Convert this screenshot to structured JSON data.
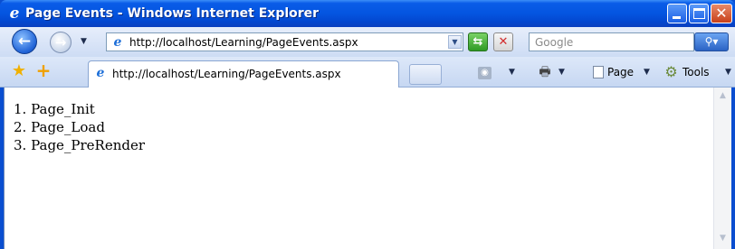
{
  "window": {
    "title": "Page Events - Windows Internet Explorer"
  },
  "navbar": {
    "address": "http://localhost/Learning/PageEvents.aspx",
    "search_placeholder": "Google"
  },
  "tabs": {
    "active_tab_title": "http://localhost/Learning/PageEvents.aspx"
  },
  "commandbar": {
    "page_label": "Page",
    "tools_label": "Tools"
  },
  "content": {
    "events": [
      "1. Page_Init",
      "2. Page_Load",
      "3. Page_PreRender"
    ]
  },
  "icons": {
    "ie": "internet-explorer-icon",
    "back": "back-arrow-icon",
    "forward": "forward-arrow-icon",
    "refresh": "refresh-icon",
    "stop": "stop-icon",
    "search": "search-icon",
    "favorites": "star-icon",
    "add_favorites": "plus-icon",
    "feeds": "rss-feed-icon",
    "print": "printer-icon",
    "page": "page-icon",
    "tools": "gear-icon"
  },
  "colors": {
    "titlebar": "#0455e0",
    "toolbar": "#dde8f9",
    "content_bg": "#ffffff"
  }
}
